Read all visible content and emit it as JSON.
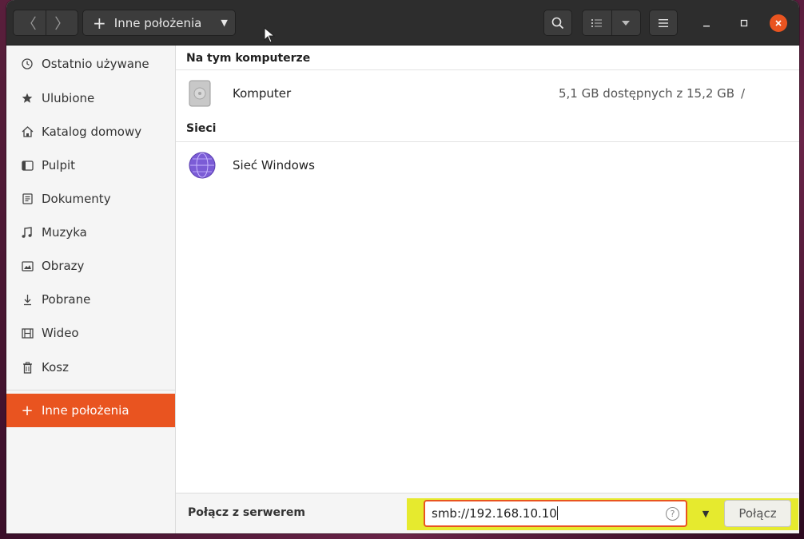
{
  "headerbar": {
    "back_glyph": "〈",
    "forward_glyph": "〉",
    "path_label": "Inne położenia",
    "path_plus": "+",
    "path_caret": "▼"
  },
  "sidebar": {
    "items": [
      {
        "label": "Ostatnio używane",
        "icon": "clock-icon"
      },
      {
        "label": "Ulubione",
        "icon": "star-icon"
      },
      {
        "label": "Katalog domowy",
        "icon": "home-icon"
      },
      {
        "label": "Pulpit",
        "icon": "desktop-icon"
      },
      {
        "label": "Dokumenty",
        "icon": "document-icon"
      },
      {
        "label": "Muzyka",
        "icon": "music-icon"
      },
      {
        "label": "Obrazy",
        "icon": "image-icon"
      },
      {
        "label": "Pobrane",
        "icon": "download-icon"
      },
      {
        "label": "Wideo",
        "icon": "video-icon"
      },
      {
        "label": "Kosz",
        "icon": "trash-icon"
      }
    ],
    "active": {
      "label": "Inne położenia",
      "icon": "plus-icon",
      "glyph": "+"
    }
  },
  "main": {
    "section_computer": "Na tym komputerze",
    "computer": {
      "name": "Komputer",
      "info": "5,1 GB dostępnych z 15,2 GB",
      "mount": "/"
    },
    "section_networks": "Sieci",
    "network": {
      "name": "Sieć Windows"
    }
  },
  "bottombar": {
    "label": "Połącz z serwerem",
    "server_value": "smb://192.168.10.10",
    "help_glyph": "?",
    "dropdown_glyph": "▼",
    "connect_label": "Połącz"
  },
  "colors": {
    "accent": "#e95420",
    "highlight": "#e6ea2e",
    "headerbar": "#2d2d2d"
  }
}
